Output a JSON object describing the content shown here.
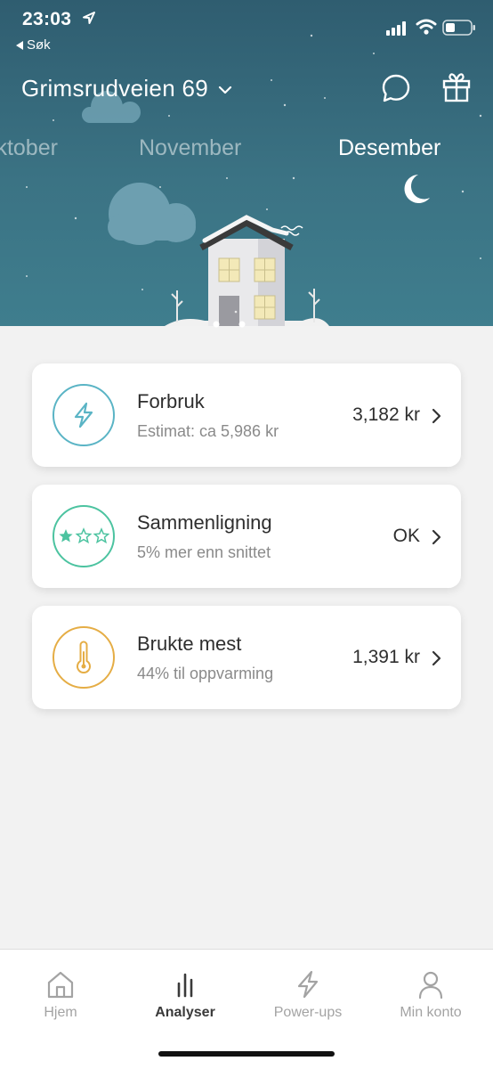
{
  "status_bar": {
    "time": "23:03",
    "back_label": "Søk",
    "icons": [
      "location-arrow-icon",
      "signal-icon",
      "wifi-icon",
      "battery-icon"
    ]
  },
  "header": {
    "address": "Grimsrudveien 69",
    "icons": [
      "chevron-down-icon",
      "chat-bubble-icon",
      "gift-icon"
    ]
  },
  "months": {
    "previous": "Oktober",
    "middle": "November",
    "current": "Desember"
  },
  "cards": [
    {
      "title": "Forbruk",
      "subtitle": "Estimat: ca 5,986 kr",
      "value": "3,182 kr",
      "icon": "lightning-icon",
      "color": "#5ab4c5"
    },
    {
      "title": "Sammenligning",
      "subtitle": "5% mer enn snittet",
      "value": "OK",
      "icon": "stars-icon",
      "color": "#4cc3a0",
      "stars_filled": 1,
      "stars_total": 3
    },
    {
      "title": "Brukte mest",
      "subtitle": "44% til oppvarming",
      "value": "1,391 kr",
      "icon": "thermometer-icon",
      "color": "#e5ad45"
    }
  ],
  "tabs": [
    {
      "label": "Hjem",
      "icon": "home-icon",
      "active": false
    },
    {
      "label": "Analyser",
      "icon": "bar-chart-icon",
      "active": true
    },
    {
      "label": "Power-ups",
      "icon": "lightning-icon",
      "active": false
    },
    {
      "label": "Min konto",
      "icon": "person-icon",
      "active": false
    }
  ],
  "colors": {
    "hero_top": "#2f5d70",
    "hero_bottom": "#3f7e8e",
    "background": "#f2f2f2"
  }
}
